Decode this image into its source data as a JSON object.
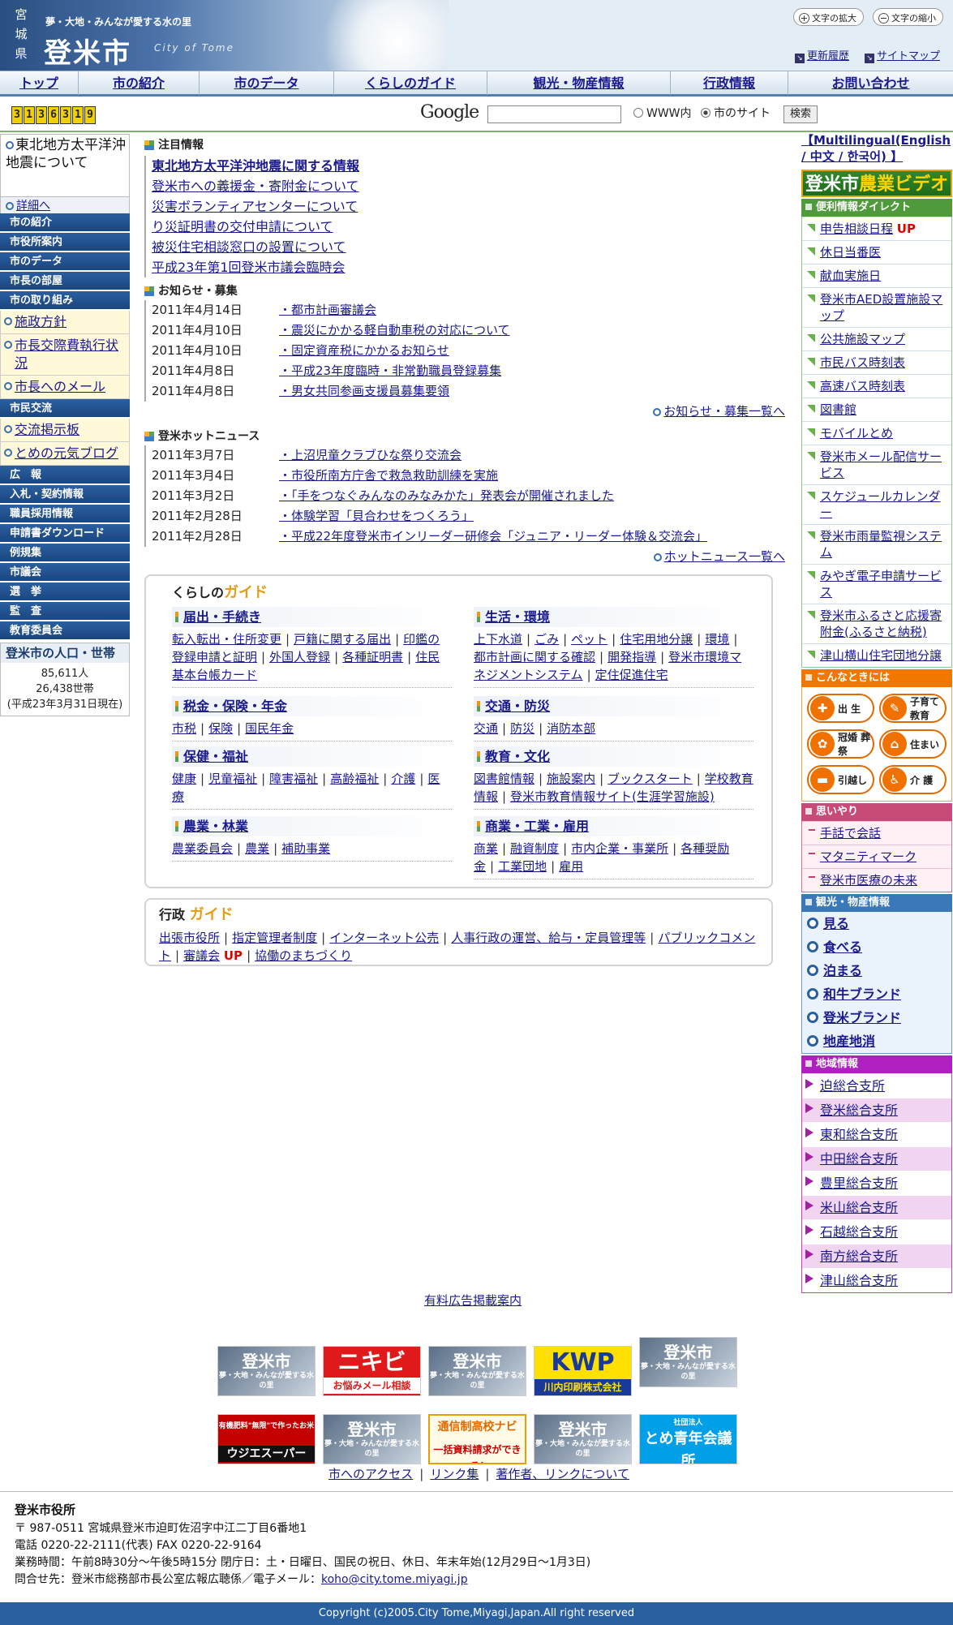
{
  "header": {
    "pref": [
      "宮",
      "城",
      "県"
    ],
    "tagline": "夢・大地・みんなが愛する水の里",
    "city": "登米市",
    "city_en": "City of Tome",
    "font_larger": "文字の拡大",
    "font_smaller": "文字の縮小",
    "update_history": "更新履歴",
    "sitemap": "サイトマップ"
  },
  "nav": [
    "トップ",
    "市の紹介",
    "市のデータ",
    "くらしのガイド",
    "観光・物産情報",
    "行政情報",
    "お問い合わせ"
  ],
  "counter": [
    "3",
    "1",
    "3",
    "6",
    "3",
    "1",
    "9"
  ],
  "search": {
    "google": "Google",
    "opt_www": "WWW内",
    "opt_site": "市のサイト",
    "button": "検索"
  },
  "left": {
    "eq_title": "東北地方太平洋沖地震について",
    "details": "詳細へ",
    "cats1": [
      "市の紹介",
      "市役所案内",
      "市のデータ",
      "市長の部屋",
      "市の取り組み"
    ],
    "subs1": [
      "施政方針",
      "市長交際費執行状況",
      "市長へのメール"
    ],
    "cat_koryu": "市民交流",
    "subs2": [
      "交流掲示板",
      "とめの元気ブログ"
    ],
    "cats2": [
      "広　報",
      "入札・契約情報",
      "職員採用情報",
      "申請書ダウンロード",
      "例規集",
      "市議会",
      "選　挙",
      "監　査",
      "教育委員会"
    ],
    "pop_title": "登米市の人口・世帯",
    "pop_people": "85,611人",
    "pop_households": "26,438世帯",
    "pop_date": "(平成23年3月31日現在)"
  },
  "attention": {
    "title": "注目情報",
    "items": [
      "東北地方太平洋沖地震に関する情報",
      "登米市への義援金・寄附金について",
      "災害ボランティアセンターについて",
      "り災証明書の交付申請について",
      "被災住宅相談窓口の設置について",
      "平成23年第1回登米市議会臨時会"
    ]
  },
  "notices": {
    "title": "お知らせ・募集",
    "items": [
      {
        "date": "2011年4月14日",
        "text": "・都市計画審議会"
      },
      {
        "date": "2011年4月10日",
        "text": "・震災にかかる軽自動車税の対応について"
      },
      {
        "date": "2011年4月10日",
        "text": "・固定資産税にかかるお知らせ"
      },
      {
        "date": "2011年4月8日",
        "text": "・平成23年度臨時・非常勤職員登録募集"
      },
      {
        "date": "2011年4月8日",
        "text": "・男女共同参画支援員募集要領"
      }
    ],
    "more": "お知らせ・募集一覧へ"
  },
  "hotnews": {
    "title": "登米ホットニュース",
    "items": [
      {
        "date": "2011年3月7日",
        "text": "・上沼児童クラブひな祭り交流会"
      },
      {
        "date": "2011年3月4日",
        "text": "・市役所南方庁舎で救急救助訓練を実施"
      },
      {
        "date": "2011年3月2日",
        "text": "・「手をつなぐみんなのみなみかた」発表会が開催されました"
      },
      {
        "date": "2011年2月28日",
        "text": "・体験学習「貝合わせをつくろう」"
      },
      {
        "date": "2011年2月28日",
        "text": "・平成22年度登米市インリーダー研修会「ジュニア・リーダー体験＆交流会」"
      }
    ],
    "more": "ホットニュース一覧へ"
  },
  "guide": {
    "title_a": "くらしの",
    "title_b": "ガイド",
    "cats": [
      {
        "name": "届出・手続き",
        "links": [
          "転入転出・住所変更",
          "戸籍に関する届出",
          "印鑑の登録申請と証明",
          "外国人登録",
          "各種証明書",
          "住民基本台帳カード"
        ]
      },
      {
        "name": "生活・環境",
        "links": [
          "上下水道",
          "ごみ",
          "ペット",
          "住宅用地分譲",
          "環境",
          "都市計画に関する確認",
          "開発指導",
          "登米市環境マネジメントシステム",
          "定住促進住宅"
        ]
      },
      {
        "name": "税金・保険・年金",
        "links": [
          "市税",
          "保険",
          "国民年金"
        ]
      },
      {
        "name": "交通・防災",
        "links": [
          "交通",
          "防災",
          "消防本部"
        ]
      },
      {
        "name": "保健・福祉",
        "links": [
          "健康",
          "児童福祉",
          "障害福祉",
          "高齢福祉",
          "介護",
          "医療"
        ]
      },
      {
        "name": "教育・文化",
        "links": [
          "図書館情報",
          "施設案内",
          "ブックスタート",
          "学校教育情報",
          "登米市教育情報サイト(生涯学習施設)"
        ]
      },
      {
        "name": "農業・林業",
        "links": [
          "農業委員会",
          "農業",
          "補助事業"
        ]
      },
      {
        "name": "商業・工業・雇用",
        "links": [
          "商業",
          "融資制度",
          "市内企業・事業所",
          "各種奨励金",
          "工業団地",
          "雇用"
        ]
      }
    ]
  },
  "gyosei": {
    "title_a": "行政",
    "title_b": "ガイド",
    "links": [
      "出張市役所",
      "指定管理者制度",
      "インターネット公売",
      "人事行政の運営、給与・定員管理等",
      "パブリックコメント",
      "審議会",
      "協働のまちづくり"
    ],
    "up": "UP"
  },
  "right": {
    "multilingual": "【Multilingual(English / 中文 / 한국어) 】",
    "agri_a": "登米市",
    "agri_b": "農業ビデオ",
    "direct_title": "便利情報ダイレクト",
    "direct": [
      "申告相談日程",
      "休日当番医",
      "献血実施日",
      "登米市AED設置施設マップ",
      "公共施設マップ",
      "市民バス時刻表",
      "高速バス時刻表",
      "図書館",
      "モバイルとめ",
      "登米市メール配信サービス",
      "スケジュールカレンダー",
      "登米市雨量監視システム",
      "みやぎ電子申請サービス",
      "登米市ふるさと応援寄附金(ふるさと納税)",
      "津山横山住宅団地分譲"
    ],
    "up": "UP",
    "konna_title": "こんなときには",
    "konna": [
      {
        "icon": "✚",
        "label": "出 生"
      },
      {
        "icon": "✎",
        "label": "子育て 教育"
      },
      {
        "icon": "✿",
        "label": "冠婚 葬祭"
      },
      {
        "icon": "⌂",
        "label": "住まい"
      },
      {
        "icon": "▬",
        "label": "引越し"
      },
      {
        "icon": "♿",
        "label": "介 護"
      }
    ],
    "omoi_title": "思いやり",
    "omoi": [
      "手話で会話",
      "マタニティマーク",
      "登米市医療の未来"
    ],
    "kanko_title": "観光・物産情報",
    "kanko": [
      "見る",
      "食べる",
      "泊まる",
      "和牛ブランド",
      "登米ブランド",
      "地産地消"
    ],
    "chiiki_title": "地域情報",
    "chiiki": [
      "迫総合支所",
      "登米総合支所",
      "東和総合支所",
      "中田総合支所",
      "豊里総合支所",
      "米山総合支所",
      "石越総合支所",
      "南方総合支所",
      "津山総合支所"
    ]
  },
  "ads": {
    "link": "有料広告掲載案内",
    "tome": "登米市",
    "tome_sub": "夢・大地・みんなが愛する水の里",
    "nikibi": "ニキビ",
    "nikibi_sub": "お悩みメール相談",
    "kwp": "KWP",
    "kwp_sub": "川内印刷株式会社",
    "uji": "ウジエスーパー",
    "uji_sub": "有機肥料\"無限\"で作ったお米",
    "tsushin": "通信制高校ナビ",
    "tsushin_sub": "一括資料請求ができる!",
    "seinen": "とめ青年会議所",
    "seinen_sub": "社団法人"
  },
  "footer": {
    "links": [
      "市へのアクセス",
      "リンク集",
      "著作者、リンクについて"
    ],
    "org": "登米市役所",
    "addr": "〒 987-0511 宮城県登米市迫町佐沼字中江二丁目6番地1",
    "tel": "電話 0220-22-2111(代表) FAX 0220-22-9164",
    "hours": "業務時間：午前8時30分～午後5時15分 閉庁日：土・日曜日、国民の祝日、休日、年末年始(12月29日～1月3日)",
    "contact_pre": "問合せ先：登米市総務部市長公室広報広聴係／電子メール：",
    "email": "koho@city.tome.miyagi.jp",
    "copyright": "Copyright (c)2005.City Tome,Miyagi,Japan.All right reserved"
  }
}
